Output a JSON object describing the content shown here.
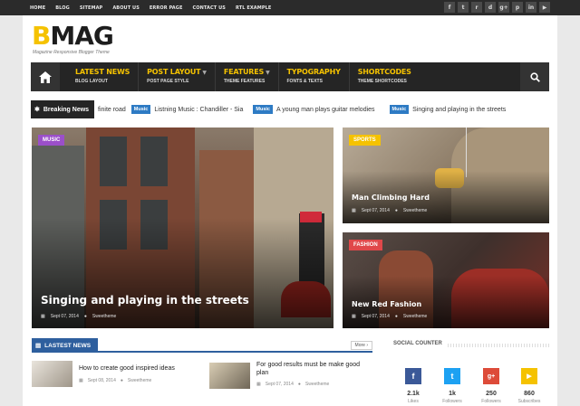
{
  "topnav": [
    "HOME",
    "BLOG",
    "SITEMAP",
    "ABOUT US",
    "ERROR PAGE",
    "CONTACT US",
    "RTL EXAMPLE"
  ],
  "social_icons": [
    "facebook-icon",
    "twitter-icon",
    "rss-icon",
    "dribbble-icon",
    "google-plus-icon",
    "pinterest-icon",
    "linkedin-icon",
    "youtube-icon"
  ],
  "social_glyphs": [
    "f",
    "t",
    "r",
    "d",
    "g+",
    "p",
    "in",
    "▶"
  ],
  "logo": {
    "first": "B",
    "rest": "MAG",
    "tagline": "Magazine Responsive Blogger Theme"
  },
  "nav": [
    {
      "title": "LATEST NEWS",
      "sub": "BLOG LAYOUT",
      "dropdown": false
    },
    {
      "title": "POST LAYOUT",
      "sub": "POST PAGE STYLE",
      "dropdown": true
    },
    {
      "title": "FEATURES",
      "sub": "THEME FEATURES",
      "dropdown": true
    },
    {
      "title": "TYPOGRAPHY",
      "sub": "FONTS & TEXTS",
      "dropdown": false
    },
    {
      "title": "SHORTCODES",
      "sub": "THEME SHORTCODES",
      "dropdown": false
    }
  ],
  "breaking": {
    "label": "Breaking News",
    "items": [
      {
        "tag": "",
        "text": "finite road"
      },
      {
        "tag": "Music",
        "text": "Listning Music : Chandiller - Sia"
      },
      {
        "tag": "Music",
        "text": "A young man plays guitar melodies"
      },
      {
        "tag": "Music",
        "text": "Singing and playing in the streets"
      }
    ]
  },
  "features": {
    "big": {
      "category": "MUSIC",
      "title": "Singing and playing in the streets",
      "date": "Sept 07, 2014",
      "author": "Sweetheme"
    },
    "top": {
      "category": "SPORTS",
      "title": "Man Climbing Hard",
      "date": "Sept 07, 2014",
      "author": "Sweetheme"
    },
    "bottom": {
      "category": "FASHION",
      "title": "New Red Fashion",
      "date": "Sept 07, 2014",
      "author": "Sweetheme"
    }
  },
  "latest": {
    "heading": "LASTEST NEWS",
    "more": "More",
    "posts": [
      {
        "title": "How to create good inspired ideas",
        "date": "Sept 08, 2014",
        "author": "Sweetheme"
      },
      {
        "title": "For good results must be make good plan",
        "date": "Sept 07, 2014",
        "author": "Sweetheme"
      }
    ]
  },
  "social_counter": {
    "heading": "SOCIAL COUNTER",
    "items": [
      {
        "icon": "facebook-icon",
        "glyph": "f",
        "color": "#3b5998",
        "count": "2.1k",
        "label": "Likes"
      },
      {
        "icon": "twitter-icon",
        "glyph": "t",
        "color": "#1da1f2",
        "count": "1k",
        "label": "Followers"
      },
      {
        "icon": "google-plus-icon",
        "glyph": "g+",
        "color": "#dd4b39",
        "count": "250",
        "label": "Followers"
      },
      {
        "icon": "youtube-icon",
        "glyph": "▶",
        "color": "#f5c200",
        "count": "860",
        "label": "Subscribes"
      }
    ]
  },
  "colors": {
    "accent": "#f5c200",
    "music": "#9b4fc9",
    "sports": "#f5c200",
    "fashion": "#e0484a",
    "blue": "#2e5f9e"
  }
}
